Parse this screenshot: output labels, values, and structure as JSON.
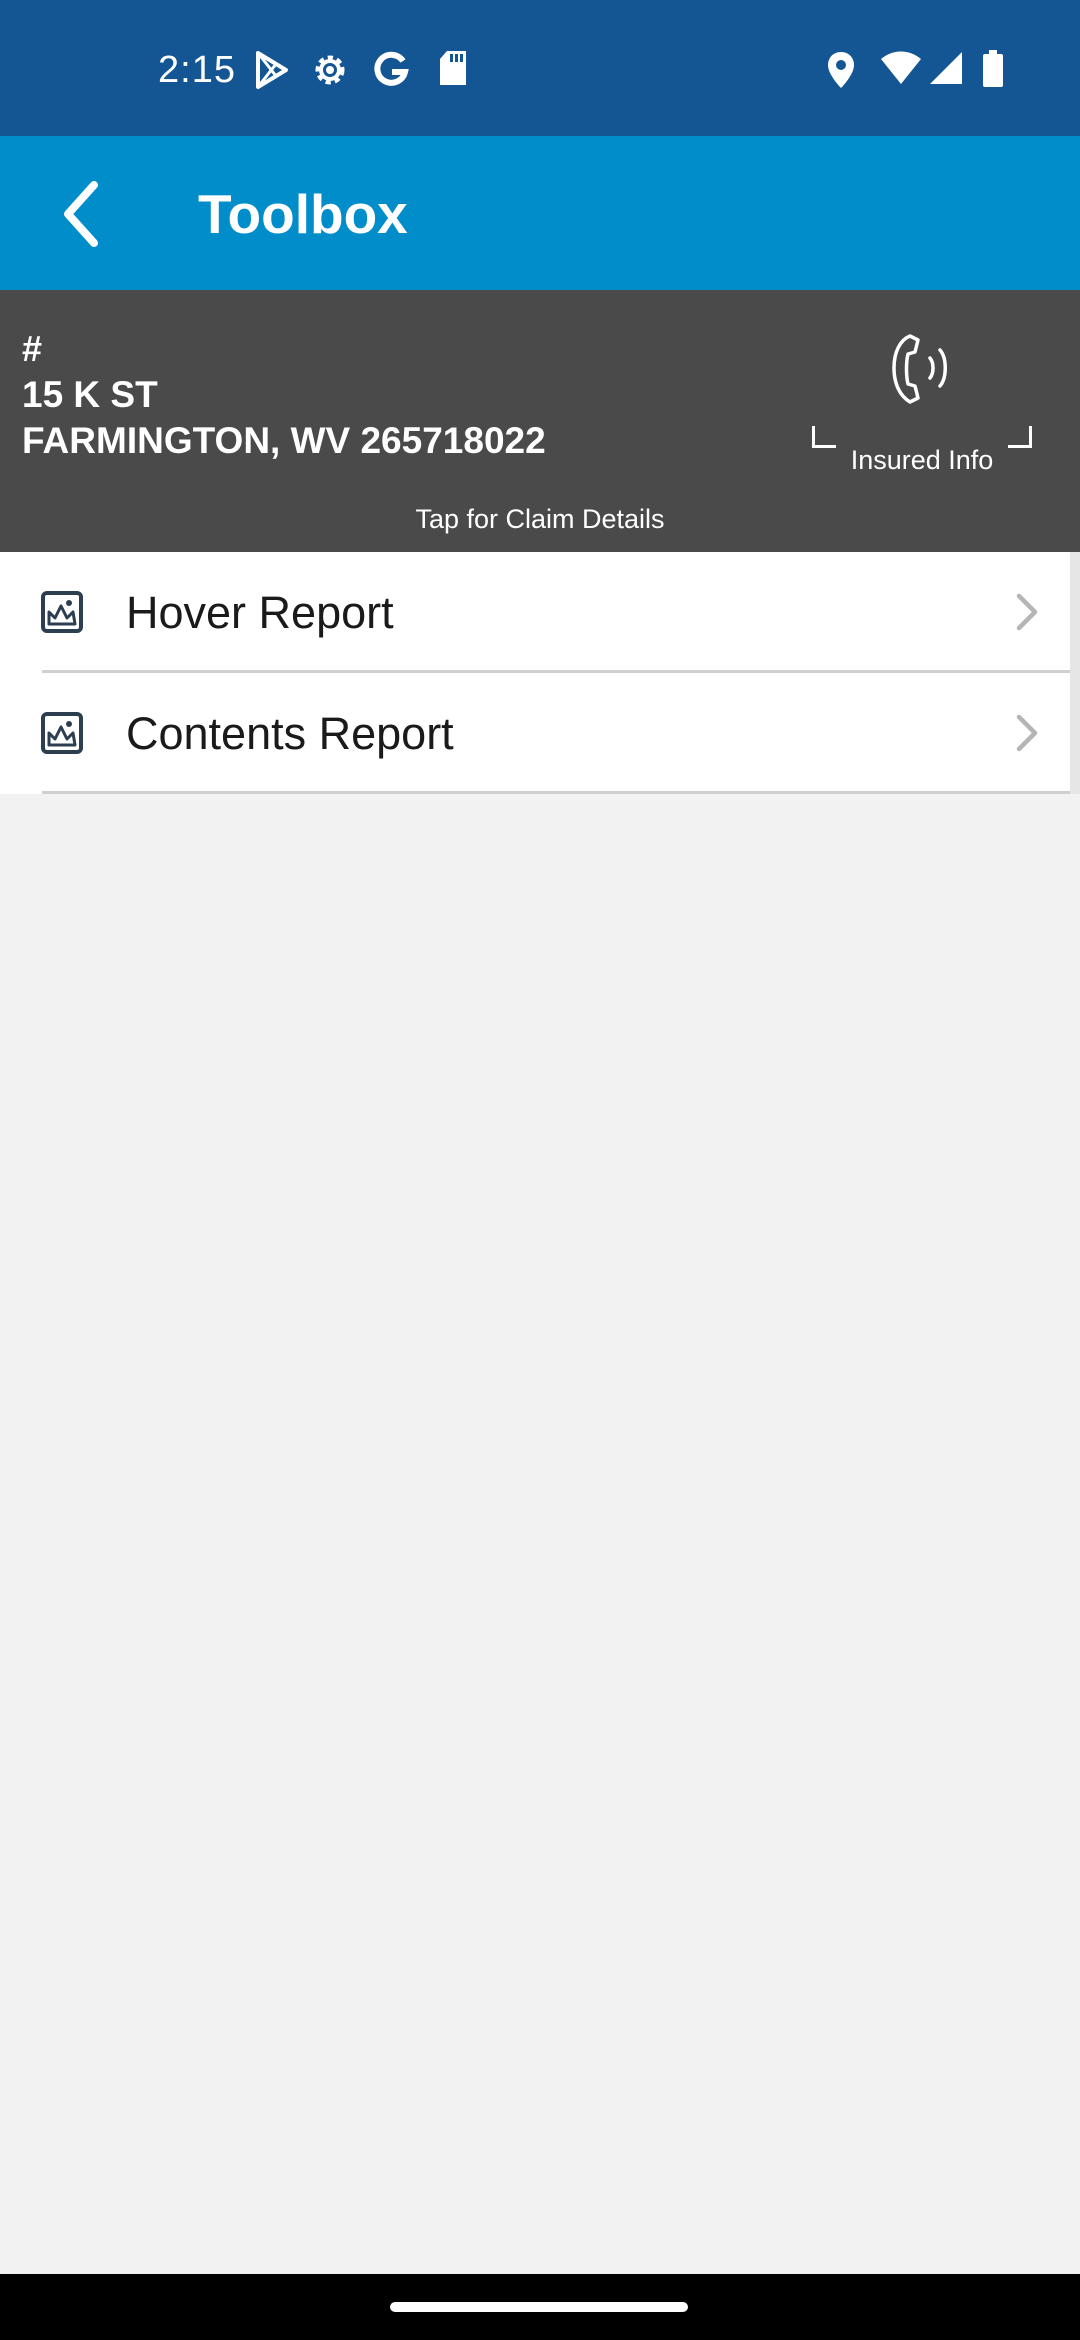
{
  "status_bar": {
    "time": "2:15",
    "left_icons": [
      "play-store-icon",
      "settings-icon",
      "google-icon",
      "sd-card-icon"
    ],
    "right_icons": [
      "location-icon",
      "wifi-icon",
      "cell-signal-icon",
      "battery-icon"
    ]
  },
  "app_bar": {
    "title": "Toolbox",
    "back_icon": "chevron-left-icon"
  },
  "claim": {
    "number": "#",
    "street": "15 K ST",
    "city_line": "FARMINGTON, WV 265718022",
    "insured_info_label": "Insured Info",
    "insured_info_icon": "phone-icon",
    "tap_hint": "Tap for Claim Details"
  },
  "reports": [
    {
      "label": "Hover Report",
      "icon": "image-report-icon"
    },
    {
      "label": "Contents Report",
      "icon": "image-report-icon"
    }
  ],
  "colors": {
    "status_bar": "#135693",
    "app_bar": "#018dca",
    "claim_header": "#4a4a4a",
    "background": "#f2f2f2"
  }
}
